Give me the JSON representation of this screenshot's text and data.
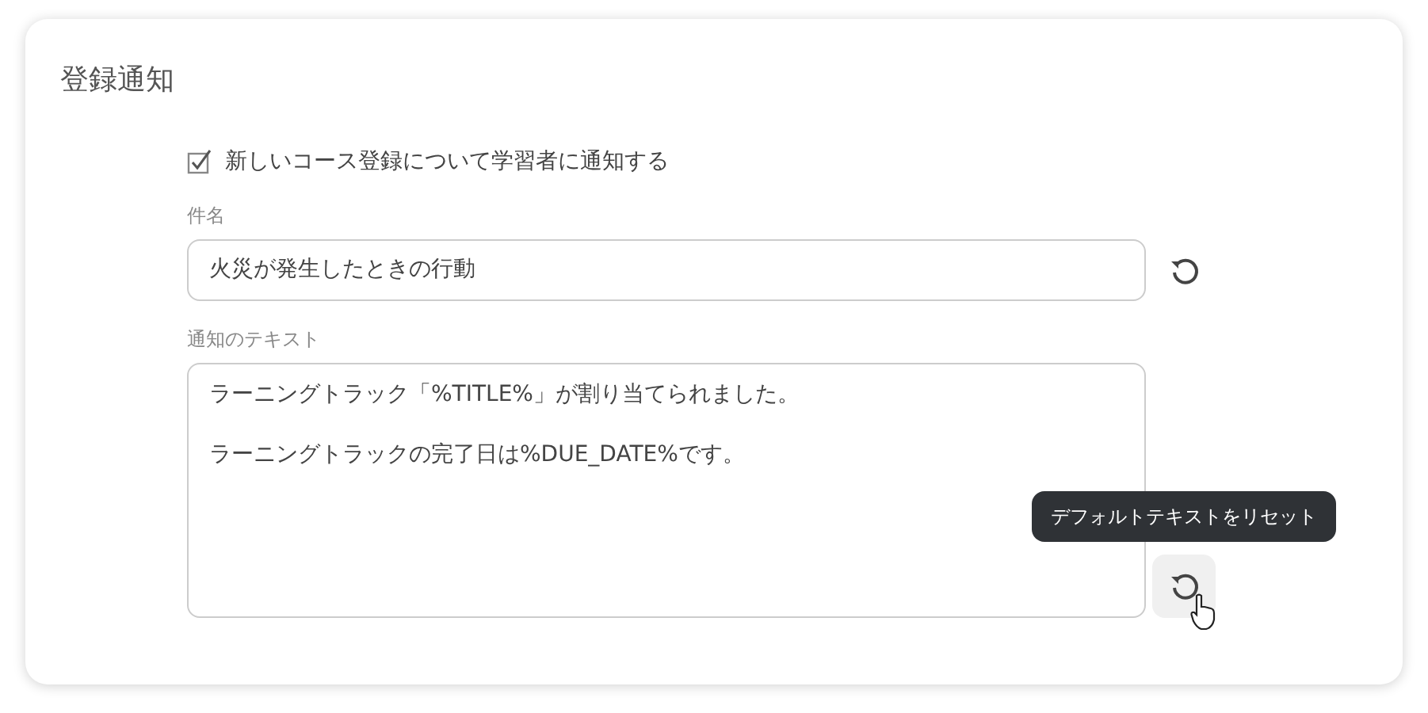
{
  "title": "登録通知",
  "notify_checkbox": {
    "label": "新しいコース登録について学習者に通知する",
    "checked": true
  },
  "fields": [
    {
      "kind": "input",
      "label": "件名",
      "value": "火災が発生したときの行動",
      "reset_button": {
        "hovered": false
      }
    },
    {
      "kind": "textarea",
      "label": "通知のテキスト",
      "paragraphs": [
        "ラーニングトラック「%TITLE%」が割り当てられました。",
        "ラーニングトラックの完了日は%DUE_DATE%です。"
      ],
      "reset_button": {
        "hovered": true,
        "tooltip": "デフォルトテキストをリセット"
      }
    }
  ]
}
